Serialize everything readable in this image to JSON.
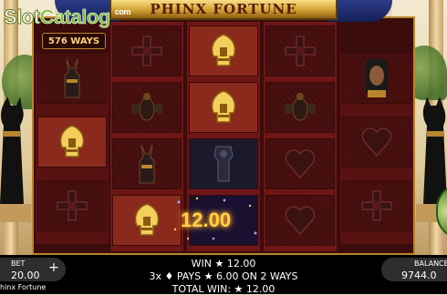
{
  "game": {
    "title": "PHINX FORTUNE",
    "ways": "576 WAYS",
    "name": "hinx Fortune"
  },
  "watermark": {
    "slot": "Slot",
    "catalog": "Catalog",
    "com": "com"
  },
  "reels": [
    [
      "anubis",
      "ankh",
      "cross"
    ],
    [
      "cross",
      "scarab",
      "anubis",
      "ankh"
    ],
    [
      "ankh",
      "ankh",
      "pharaoh",
      "sparkle"
    ],
    [
      "cross",
      "scarab",
      "heart",
      "heart"
    ],
    [
      "cleopatra",
      "heart",
      "cross"
    ]
  ],
  "win_display": {
    "amount": "12.00"
  },
  "bottom": {
    "bet_label": "BET",
    "bet_value": "20.00",
    "balance_label": "BALANCE",
    "balance_value": "9744.0",
    "plus": "+",
    "win_line": "WIN ★ 12.00",
    "pays_line": "3x ♦ PAYS ★ 6.00 ON 2 WAYS",
    "total_line": "TOTAL WIN: ★ 12.00"
  },
  "colors": {
    "reel_frame": "#3a0c0c",
    "gold": "#d9a93a",
    "win_text": "#ffd24a",
    "bottom_bar": "#000000"
  }
}
